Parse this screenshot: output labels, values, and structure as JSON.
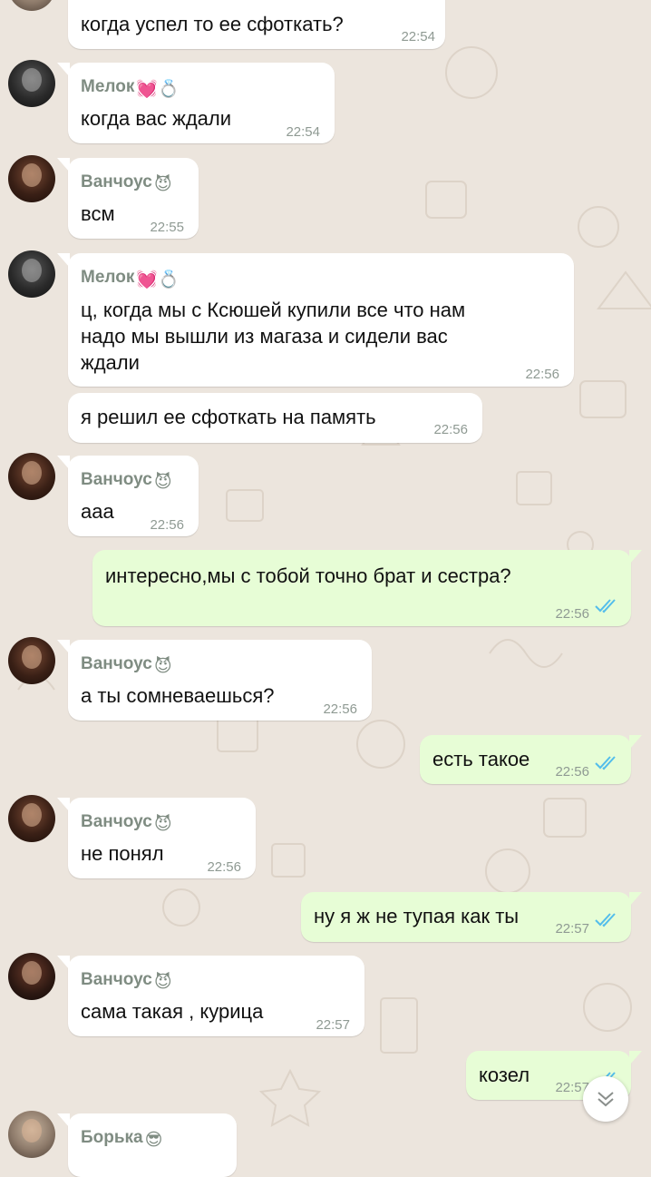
{
  "colors": {
    "incoming_bubble": "#ffffff",
    "outgoing_bubble": "#e7fdd6",
    "sender_name": "#7f8c82",
    "timestamp": "#8f9a93",
    "read_ticks": "#53bdeb",
    "wallpaper": "#ece5dd"
  },
  "messages": [
    {
      "direction": "in",
      "sender": "",
      "text": "когда успел то ее сфоткать?",
      "time": "22:54"
    },
    {
      "direction": "in",
      "sender": "Мелок",
      "sender_emoji": "💓💍",
      "text": "когда вас ждали",
      "time": "22:54"
    },
    {
      "direction": "in",
      "sender": "Ванчоус",
      "sender_emoji": "😈",
      "text": "всм",
      "time": "22:55"
    },
    {
      "direction": "in",
      "sender": "Мелок",
      "sender_emoji": "💓💍",
      "text": "ц, когда мы с Ксюшей купили все что нам\nнадо мы вышли из магаза и сидели вас\nждали",
      "time": "22:56"
    },
    {
      "direction": "in",
      "sender": "",
      "text": "я решил ее сфоткать на память",
      "time": "22:56"
    },
    {
      "direction": "in",
      "sender": "Ванчоус",
      "sender_emoji": "😈",
      "text": "ааа",
      "time": "22:56"
    },
    {
      "direction": "out",
      "text": "интересно,мы с тобой точно брат и сестра?",
      "time": "22:56",
      "status": "read"
    },
    {
      "direction": "in",
      "sender": "Ванчоус",
      "sender_emoji": "😈",
      "text": "а ты сомневаешься?",
      "time": "22:56"
    },
    {
      "direction": "out",
      "text": "есть такое",
      "time": "22:56",
      "status": "read"
    },
    {
      "direction": "in",
      "sender": "Ванчоус",
      "sender_emoji": "😈",
      "text": "не понял",
      "time": "22:56"
    },
    {
      "direction": "out",
      "text": "ну я ж не тупая как ты",
      "time": "22:57",
      "status": "read"
    },
    {
      "direction": "in",
      "sender": "Ванчоус",
      "sender_emoji": "😈",
      "text": "сама такая , курица",
      "time": "22:57"
    },
    {
      "direction": "out",
      "text": "козел",
      "time": "22:57",
      "status": "read"
    },
    {
      "direction": "in",
      "sender": "Борька",
      "sender_emoji": "😎",
      "text": "",
      "time": ""
    }
  ],
  "scroll_button": {
    "icon": "double-chevron-down-icon"
  }
}
